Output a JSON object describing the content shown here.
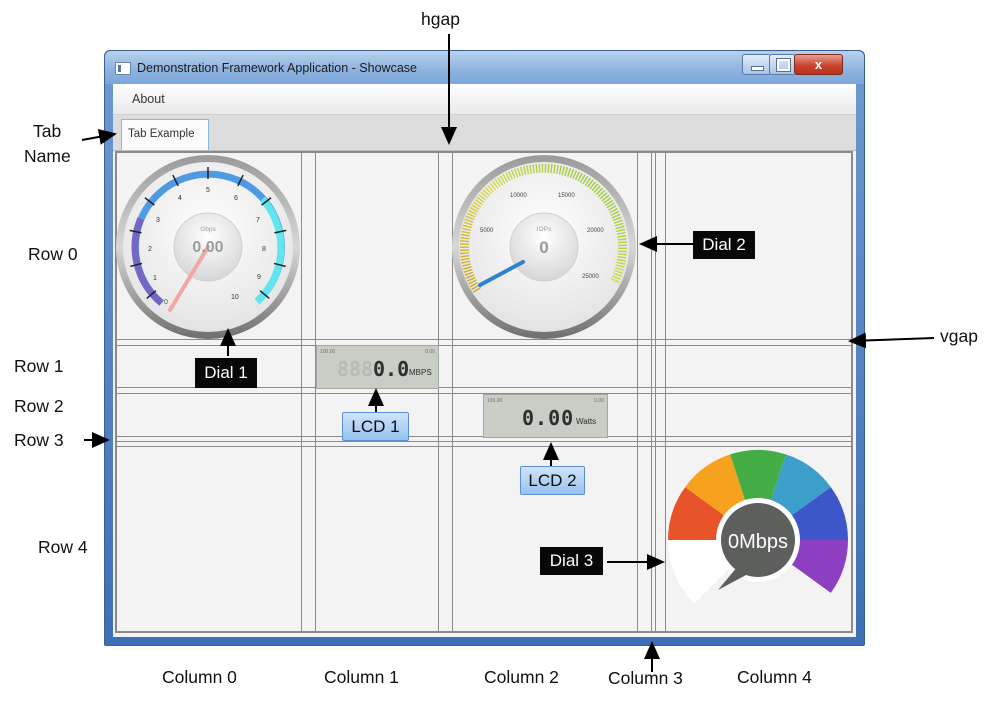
{
  "window": {
    "title": "Demonstration Framework Application - Showcase",
    "menu": [
      "About"
    ],
    "tab_label": "Tab Example",
    "close_glyph": "x"
  },
  "dial1": {
    "ticks": [
      "1",
      "2",
      "3",
      "4",
      "5",
      "6",
      "7",
      "8",
      "9",
      "10"
    ],
    "unit": "Gbps",
    "value": "0.00"
  },
  "dial2": {
    "ticks": [
      "5000",
      "10000",
      "15000",
      "20000",
      "25000"
    ],
    "unit": "IOPs",
    "value": "0"
  },
  "lcd1": {
    "value": "0.0",
    "unit": "MBPS",
    "ghost": "888",
    "min": "100.00",
    "max": "0.00"
  },
  "lcd2": {
    "value": "0.00",
    "unit": "Watts",
    "min": "100.00",
    "max": "0.00"
  },
  "dial3": {
    "value": "0Mbps",
    "colors": [
      "#e8542a",
      "#f6a21e",
      "#45ad45",
      "#3b9fc9",
      "#3d57c8",
      "#8d3fc2"
    ]
  },
  "annotations": {
    "hgap": "hgap",
    "vgap": "vgap",
    "tab_name": [
      "Tab",
      "Name"
    ],
    "rows": [
      "Row 0",
      "Row 1",
      "Row 2",
      "Row 3",
      "Row 4"
    ],
    "columns": [
      "Column 0",
      "Column 1",
      "Column 2",
      "Column 3",
      "Column 4"
    ],
    "dial1": "Dial 1",
    "dial2": "Dial 2",
    "dial3": "Dial 3",
    "lcd1": "LCD 1",
    "lcd2": "LCD 2"
  }
}
